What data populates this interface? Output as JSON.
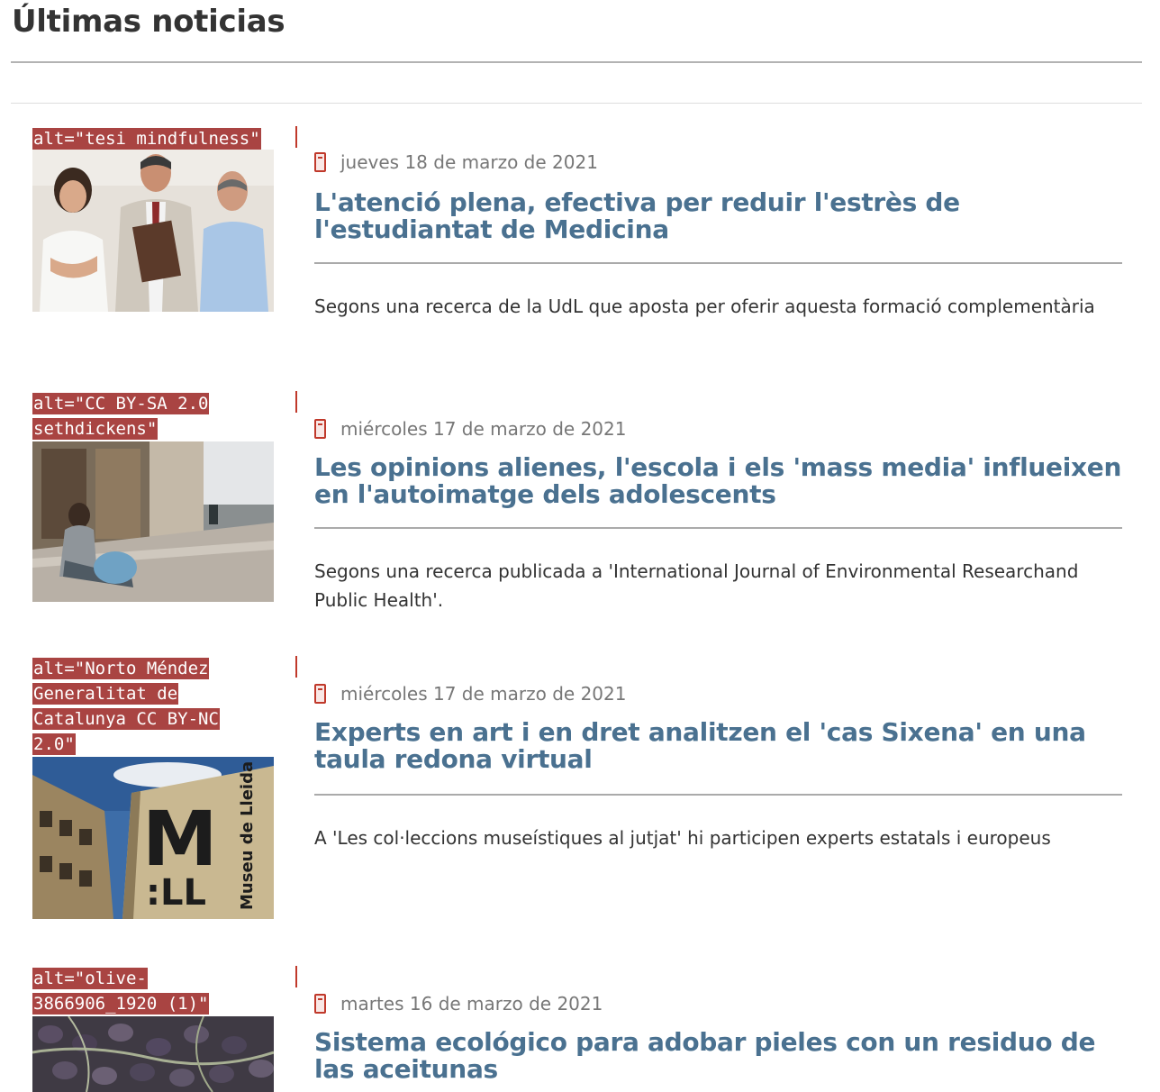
{
  "section": {
    "title": "Últimas noticias"
  },
  "news": [
    {
      "alt": "alt=\"tesi mindfulness\"",
      "date": "jueves 18 de marzo de 2021",
      "title": "L'atenció plena, efectiva per reduir l'estrès de l'estudiantat de Medicina",
      "summary": "Segons una recerca de la UdL que aposta per oferir aquesta formació complementària"
    },
    {
      "alt": "alt=\"CC BY-SA 2.0 sethdickens\"",
      "date": "miércoles 17 de marzo de 2021",
      "title": "Les opinions alienes, l'escola i els 'mass media' influeixen en l'autoimatge dels adolescents",
      "summary": "Segons una recerca publicada a 'International Journal of Environmental Researchand Public Health'."
    },
    {
      "alt": "alt=\"Norto Méndez Generalitat de Catalunya CC BY-NC 2.0\"",
      "date": "miércoles 17 de marzo de 2021",
      "title": "Experts en art i en dret analitzen el 'cas Sixena' en una taula redona virtual",
      "summary": "A 'Les col·leccions museístiques al jutjat' hi participen experts estatals i europeus",
      "image_text": {
        "logo": "M",
        "logo_sub": ":LL",
        "vertical": "Museu de Lleida"
      }
    },
    {
      "alt": "alt=\"olive-3866906_1920 (1)\"",
      "date": "martes 16 de marzo de 2021",
      "title": "Sistema ecológico para adobar pieles con un residuo de las aceitunas",
      "summary": ""
    }
  ],
  "colors": {
    "accent": "#c0392b",
    "link": "#4a7190",
    "alt_bg": "#a94442"
  },
  "icons": {
    "date": "calendar-icon"
  }
}
